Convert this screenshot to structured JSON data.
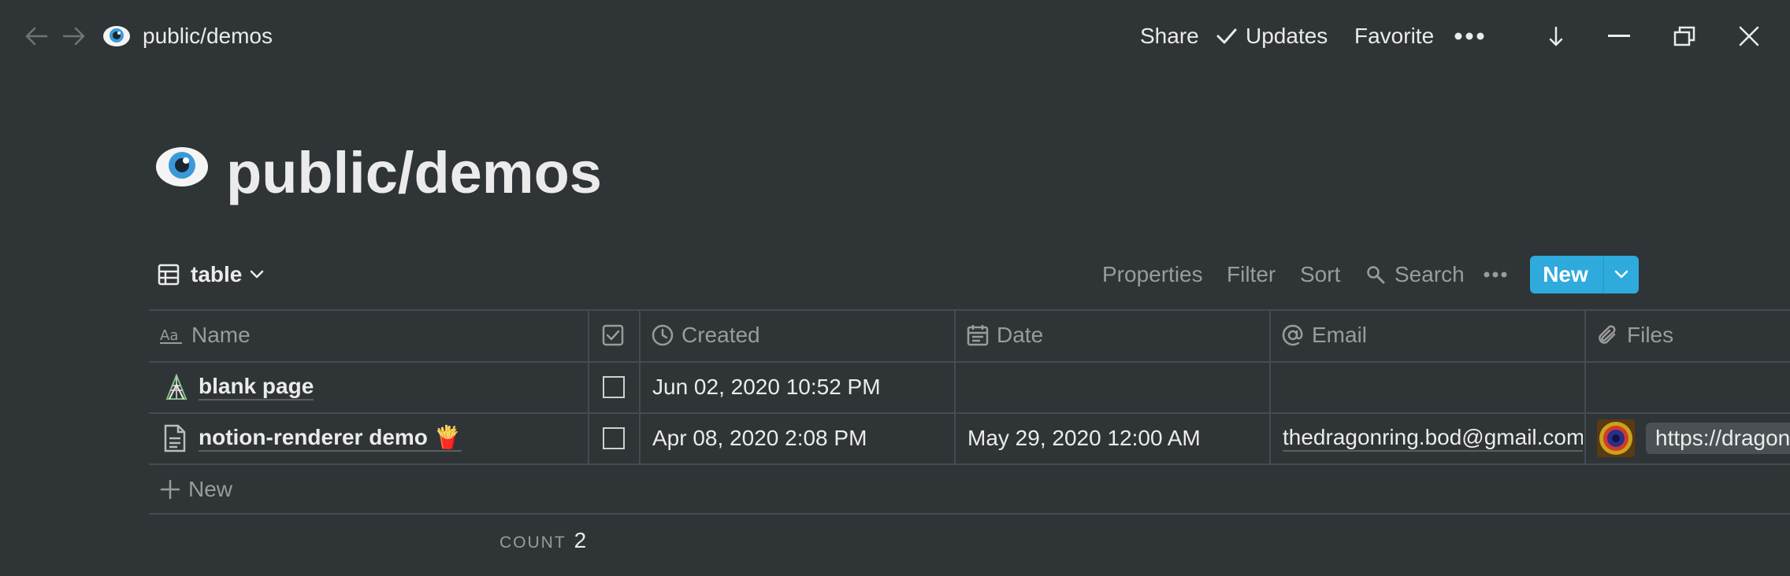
{
  "topbar": {
    "breadcrumb": "public/demos",
    "share": "Share",
    "updates": "Updates",
    "favorite": "Favorite"
  },
  "page": {
    "title": "public/demos"
  },
  "view": {
    "name": "table",
    "properties": "Properties",
    "filter": "Filter",
    "sort": "Sort",
    "search": "Search",
    "new": "New"
  },
  "columns": {
    "name": "Name",
    "created": "Created",
    "date": "Date",
    "email": "Email",
    "files": "Files"
  },
  "rows": [
    {
      "name": "blank page",
      "checked": false,
      "created": "Jun 02, 2020 10:52 PM",
      "date": "",
      "email": "",
      "file": ""
    },
    {
      "name": "notion-renderer demo 🍟",
      "checked": false,
      "created": "Apr 08, 2020 2:08 PM",
      "date": "May 29, 2020 12:00 AM",
      "email": "thedragonring.bod@gmail.com",
      "file": "https://dragon"
    }
  ],
  "footer": {
    "new_row": "New",
    "count_label": "COUNT",
    "count_value": "2"
  },
  "colors": {
    "background": "#2f3437",
    "accent": "#2eaadc",
    "text": "#ebebeb",
    "muted": "#9b9b9b"
  }
}
